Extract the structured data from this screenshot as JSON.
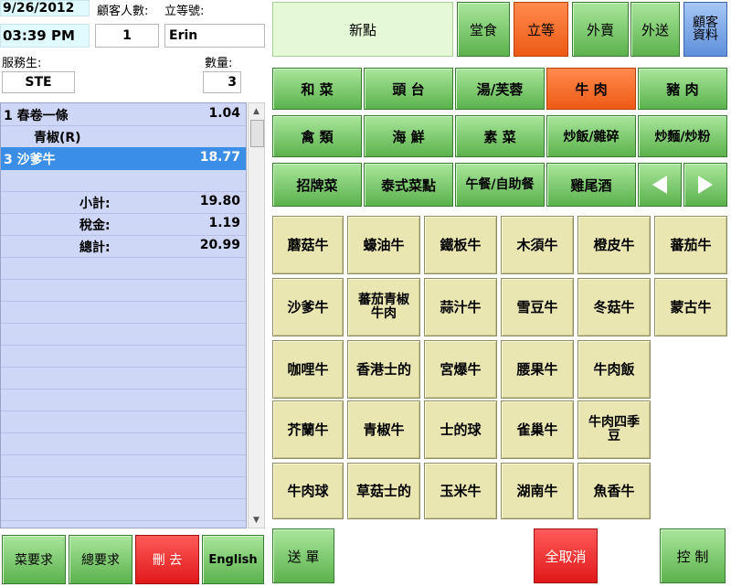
{
  "header": {
    "date": "9/26/2012",
    "time": "03:39 PM",
    "guest_count_label": "顧客人數:",
    "ticket_label": "立等號:",
    "guest_count": "1",
    "customer_name": "Erin",
    "server_label": "服務生:",
    "server": "STE",
    "quantity_label": "數量:",
    "quantity": "3"
  },
  "order": {
    "items": [
      {
        "qty": "1",
        "name": "春卷一條",
        "price": "1.04",
        "selected": false
      },
      {
        "qty": "",
        "name": "青椒(R)",
        "price": "",
        "selected": false,
        "modifier": true
      },
      {
        "qty": "3",
        "name": "沙爹牛",
        "price": "18.77",
        "selected": true
      }
    ],
    "subtotal_label": "小計:",
    "subtotal": "19.80",
    "tax_label": "稅金:",
    "tax": "1.19",
    "total_label": "總計:",
    "total": "20.99"
  },
  "order_types": {
    "new_label": "新點",
    "dine_in": "堂食",
    "wait": "立等",
    "takeout": "外賣",
    "delivery": "外送",
    "customer_info": "顧客資料",
    "active": "立等"
  },
  "categories": [
    [
      "和 菜",
      "頭 台",
      "湯/芙蓉",
      "牛 肉",
      "豬 肉"
    ],
    [
      "禽 類",
      "海 鮮",
      "素 菜",
      "炒飯/雜碎",
      "炒麵/炒粉"
    ],
    [
      "招牌菜",
      "泰式菜點",
      "午餐/自助餐",
      "雞尾酒"
    ]
  ],
  "active_category": "牛 肉",
  "menu_items": [
    [
      "蘑菇牛",
      "蠔油牛",
      "鐵板牛",
      "木須牛",
      "橙皮牛",
      "蕃茄牛"
    ],
    [
      "沙爹牛",
      "蕃茄青椒牛肉",
      "蒜汁牛",
      "雪豆牛",
      "冬菇牛",
      "蒙古牛"
    ],
    [
      "咖哩牛",
      "香港士的",
      "宮爆牛",
      "腰果牛",
      "牛肉飯"
    ],
    [
      "芥蘭牛",
      "青椒牛",
      "士的球",
      "雀巢牛",
      "牛肉四季豆"
    ],
    [
      "牛肉球",
      "草菇士的",
      "玉米牛",
      "湖南牛",
      "魚香牛"
    ]
  ],
  "bottom": {
    "dish_request": "菜要求",
    "general_request": "總要求",
    "delete": "刪 去",
    "english": "English",
    "send": "送 單",
    "cancel_all": "全取消",
    "control": "控 制"
  },
  "colors": {
    "green_button": "#5bb24c",
    "active_orange": "#ee5a15",
    "delete_red": "#e01818",
    "menu_item": "#e9e6b2",
    "order_list": "#cfd7f7",
    "selected_row": "#3a8ee6"
  }
}
